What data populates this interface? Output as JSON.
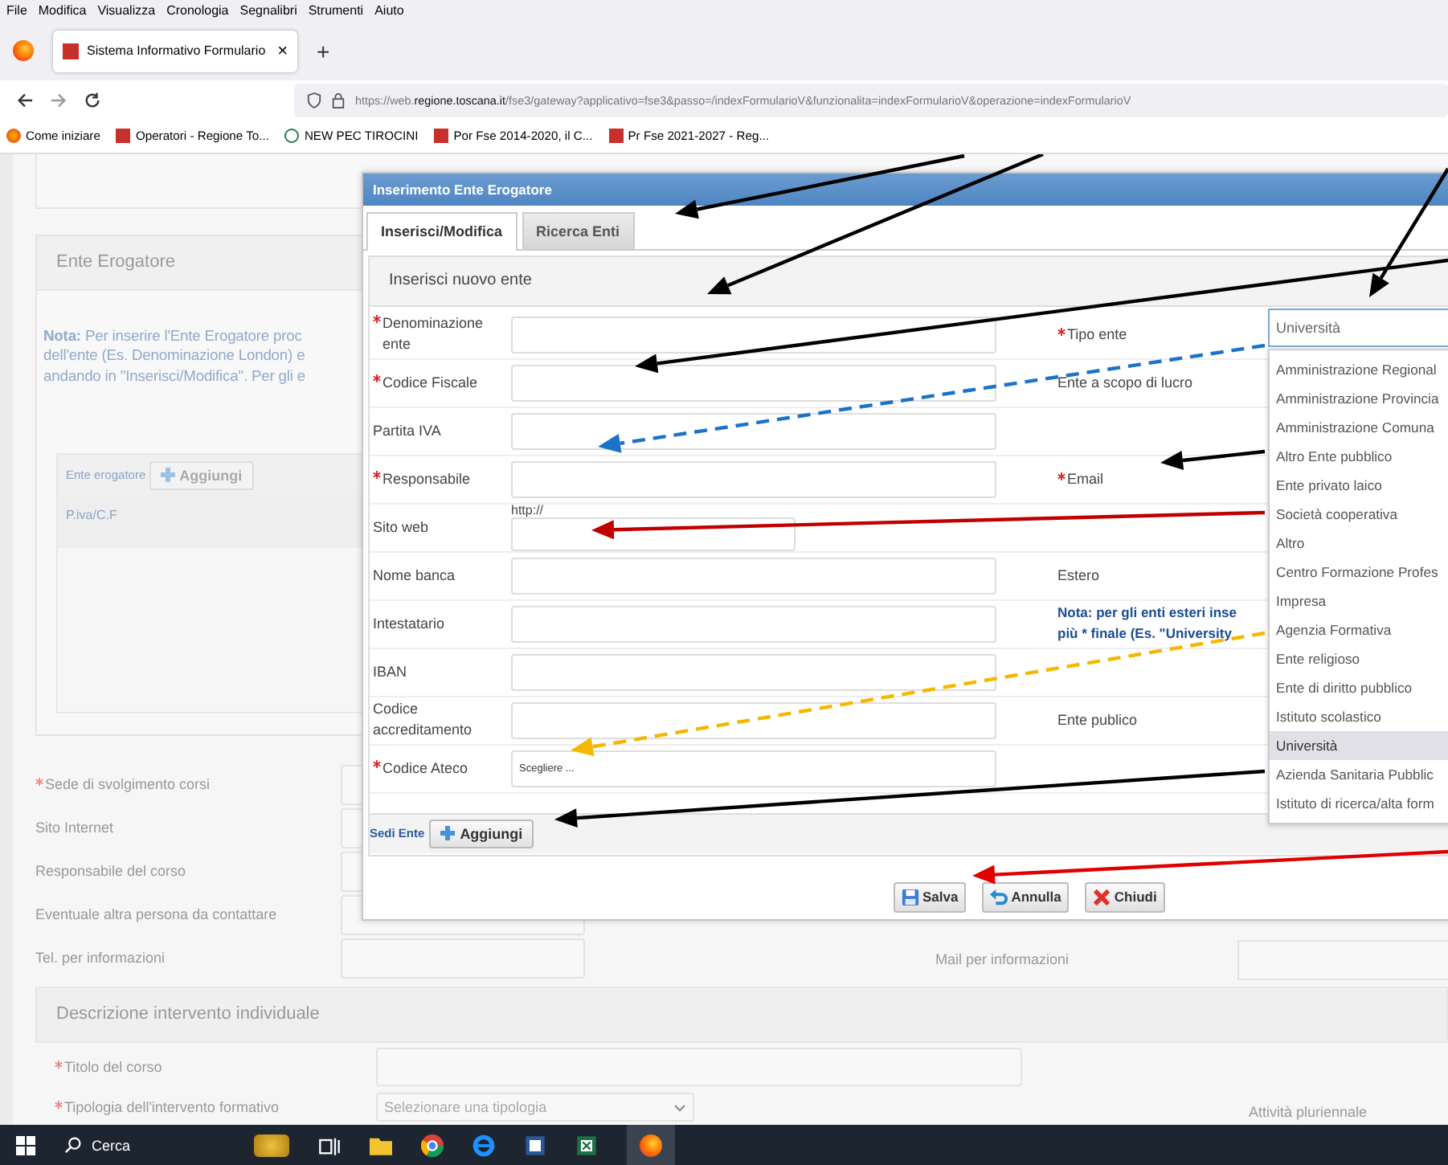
{
  "menu_bar": [
    "File",
    "Modifica",
    "Visualizza",
    "Cronologia",
    "Segnalibri",
    "Strumenti",
    "Aiuto"
  ],
  "browser_tab": {
    "title": "Sistema Informativo Formulario",
    "close": "×",
    "selected": true
  },
  "new_tab": "+",
  "address_bar": {
    "url": "https://web.**regione.toscana.it**/fse3/gateway?applicativo=fse3&passo=/indexFormularioV&funzionalita=indexFormularioV&operazione=indexFormularioV"
  },
  "bookmarks": [
    {
      "label": "Come iniziare",
      "kind": "firefox"
    },
    {
      "label": "Operatori - Regione To...",
      "kind": "site"
    },
    {
      "label": "NEW PEC TIROCINI",
      "kind": "pec"
    },
    {
      "label": "Por Fse 2014-2020, il C...",
      "kind": "site"
    },
    {
      "label": "Pr Fse 2021-2027 - Reg...",
      "kind": "site"
    }
  ],
  "page": {
    "ente_section": {
      "title": "Ente Erogatore",
      "note_lines": [
        "**Nota:** Per inserire l'Ente Erogatore proc",
        "dell'ente (Es. Denominazione London) e",
        "andando in \"Inserisci/Modifica\". Per gli e"
      ],
      "table_label": "Ente erogatore",
      "add_button": "Aggiungi",
      "column": "P.iva/C.F"
    },
    "fields": [
      {
        "label": "Sede di svolgimento corsi",
        "required": true
      },
      {
        "label": "Sito Internet",
        "required": false
      },
      {
        "label": "Responsabile del corso",
        "required": false
      },
      {
        "label": "Eventuale altra persona da contattare",
        "required": false
      },
      {
        "label": "Tel. per informazioni",
        "required": false
      }
    ],
    "mail_label": "Mail per informazioni",
    "description_section": {
      "title": "Descrizione intervento individuale",
      "fields": [
        {
          "label": "Titolo del corso",
          "required": true,
          "kind": "input"
        },
        {
          "label": "Tipologia dell'intervento formativo",
          "required": true,
          "kind": "select",
          "placeholder": "Selezionare una tipologia"
        }
      ],
      "side_label": "Attività pluriennale"
    }
  },
  "dialog": {
    "title": "Inserimento Ente Erogatore",
    "tabs": [
      {
        "label": "Inserisci/Modifica",
        "selected": true
      },
      {
        "label": "Ricerca Enti",
        "selected": false
      }
    ],
    "panel_title": "Inserisci nuovo ente",
    "rows": [
      {
        "label": "Denominazione ente",
        "required": true,
        "kind": "input",
        "right": {
          "label": "Tipo ente",
          "required": true,
          "kind": "label"
        }
      },
      {
        "label": "Codice Fiscale",
        "required": true,
        "kind": "input",
        "right": {
          "label": "Ente a scopo di lucro",
          "required": false,
          "kind": "label"
        }
      },
      {
        "label": "Partita IVA",
        "required": false,
        "kind": "input"
      },
      {
        "label": "Responsabile",
        "required": true,
        "kind": "input",
        "right": {
          "label": "Email",
          "required": true,
          "kind": "label"
        }
      },
      {
        "label": "Sito web",
        "required": false,
        "kind": "short",
        "prefix": "http://"
      },
      {
        "label": "Nome banca",
        "required": false,
        "kind": "input",
        "right": {
          "label": "Estero",
          "required": false,
          "kind": "label"
        }
      },
      {
        "label": "Intestatario",
        "required": false,
        "kind": "input",
        "right": {
          "label": "Nota: per gli enti esteri inse\npiù * finale (Es. \"University",
          "kind": "note"
        }
      },
      {
        "label": "IBAN",
        "required": false,
        "kind": "input"
      },
      {
        "label": "Codice accreditamento",
        "required": false,
        "kind": "input",
        "right": {
          "label": "Ente publico",
          "required": false,
          "kind": "label"
        }
      },
      {
        "label": "Codice Ateco",
        "required": true,
        "kind": "select",
        "value": "Scegliere ..."
      }
    ],
    "sedi": {
      "label": "Sedi Ente",
      "add_button": "Aggiungi"
    },
    "type_select": {
      "value": "Università",
      "options": [
        {
          "label": "Amministrazione Regional",
          "selected": false
        },
        {
          "label": "Amministrazione Provincia",
          "selected": false
        },
        {
          "label": "Amministrazione Comuna",
          "selected": false
        },
        {
          "label": "Altro Ente pubblico",
          "selected": false
        },
        {
          "label": "Ente privato laico",
          "selected": false
        },
        {
          "label": "Società cooperativa",
          "selected": false
        },
        {
          "label": "Altro",
          "selected": false
        },
        {
          "label": "Centro Formazione Profes",
          "selected": false
        },
        {
          "label": "Impresa",
          "selected": false
        },
        {
          "label": "Agenzia Formativa",
          "selected": false
        },
        {
          "label": "Ente religioso",
          "selected": false
        },
        {
          "label": "Ente di diritto pubblico",
          "selected": false
        },
        {
          "label": "Istituto scolastico",
          "selected": false
        },
        {
          "label": "Università",
          "selected": true
        },
        {
          "label": "Azienda Sanitaria Pubblic",
          "selected": false
        },
        {
          "label": "Istituto di ricerca/alta form",
          "selected": false
        }
      ]
    },
    "buttons": [
      {
        "label": "Salva",
        "kind": "save"
      },
      {
        "label": "Annulla",
        "kind": "undo"
      },
      {
        "label": "Chiudi",
        "kind": "close"
      }
    ]
  },
  "taskbar": {
    "search": "Cerca"
  }
}
